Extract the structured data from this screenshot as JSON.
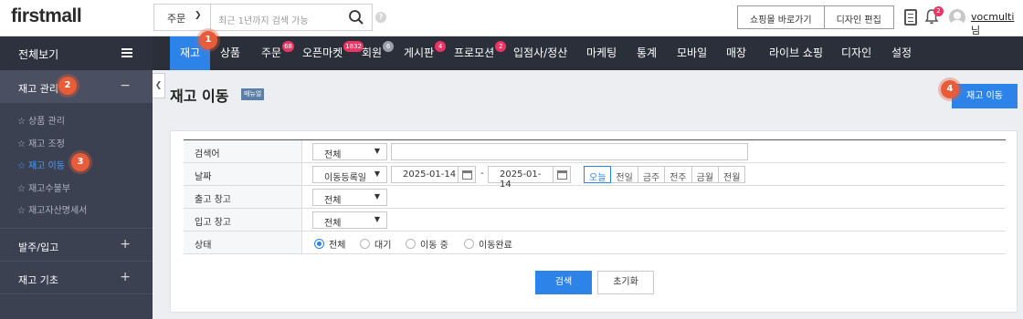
{
  "header": {
    "logo": "firstmall",
    "search": {
      "select": "주문",
      "placeholder": "최근 1년까지 검색 가능"
    },
    "help": "?",
    "buttons": [
      "쇼핑몰 바로가기",
      "디자인 편집"
    ],
    "notification_count": "2",
    "user": {
      "name": "vocmulti",
      "suffix": "님"
    }
  },
  "gnb": [
    {
      "label": "재고",
      "active": true
    },
    {
      "label": "상품"
    },
    {
      "label": "주문",
      "badge": "68"
    },
    {
      "label": "오픈마켓",
      "badge": "1832"
    },
    {
      "label": "회원",
      "badge": "6",
      "badge_style": "gray"
    },
    {
      "label": "게시판",
      "badge": "4"
    },
    {
      "label": "프로모션",
      "badge": "2"
    },
    {
      "label": "입점사/정산"
    },
    {
      "label": "마케팅"
    },
    {
      "label": "통계"
    },
    {
      "label": "모바일"
    },
    {
      "label": "매장"
    },
    {
      "label": "라이브 쇼핑"
    },
    {
      "label": "디자인"
    },
    {
      "label": "설정"
    }
  ],
  "sidebar": {
    "title": "전체보기",
    "sections": [
      {
        "label": "재고 관리",
        "toggle": "−",
        "items": [
          "상품 관리",
          "재고 조정",
          "재고 이동",
          "재고수불부",
          "재고자산명세서"
        ],
        "active_item": "재고 이동"
      },
      {
        "label": "발주/입고",
        "toggle": "+"
      },
      {
        "label": "재고 기초",
        "toggle": "+"
      }
    ]
  },
  "page": {
    "title": "재고 이동",
    "manual": "매뉴얼",
    "action_button": "재고 이동"
  },
  "filters": {
    "keyword": {
      "label": "검색어",
      "select": "전체",
      "value": ""
    },
    "date": {
      "label": "날짜",
      "select": "이동등록일",
      "from": "2025-01-14",
      "to": "2025-01-14",
      "sep": "-",
      "quick": [
        "오늘",
        "전일",
        "금주",
        "전주",
        "금월",
        "전월"
      ],
      "quick_selected": "오늘"
    },
    "out_warehouse": {
      "label": "출고 창고",
      "select": "전체"
    },
    "in_warehouse": {
      "label": "입고 창고",
      "select": "전체"
    },
    "status": {
      "label": "상태",
      "options": [
        "전체",
        "대기",
        "이동 중",
        "이동완료"
      ],
      "selected": "전체"
    },
    "search_button": "검색",
    "reset_button": "초기화"
  },
  "steps": [
    "1",
    "2",
    "3",
    "4"
  ],
  "colors": {
    "accent": "#2d83e8",
    "gnb_bg": "#2b2f3a",
    "sidebar_bg": "#3c4151",
    "badge": "#ee3465",
    "step": "#e85c3a"
  }
}
